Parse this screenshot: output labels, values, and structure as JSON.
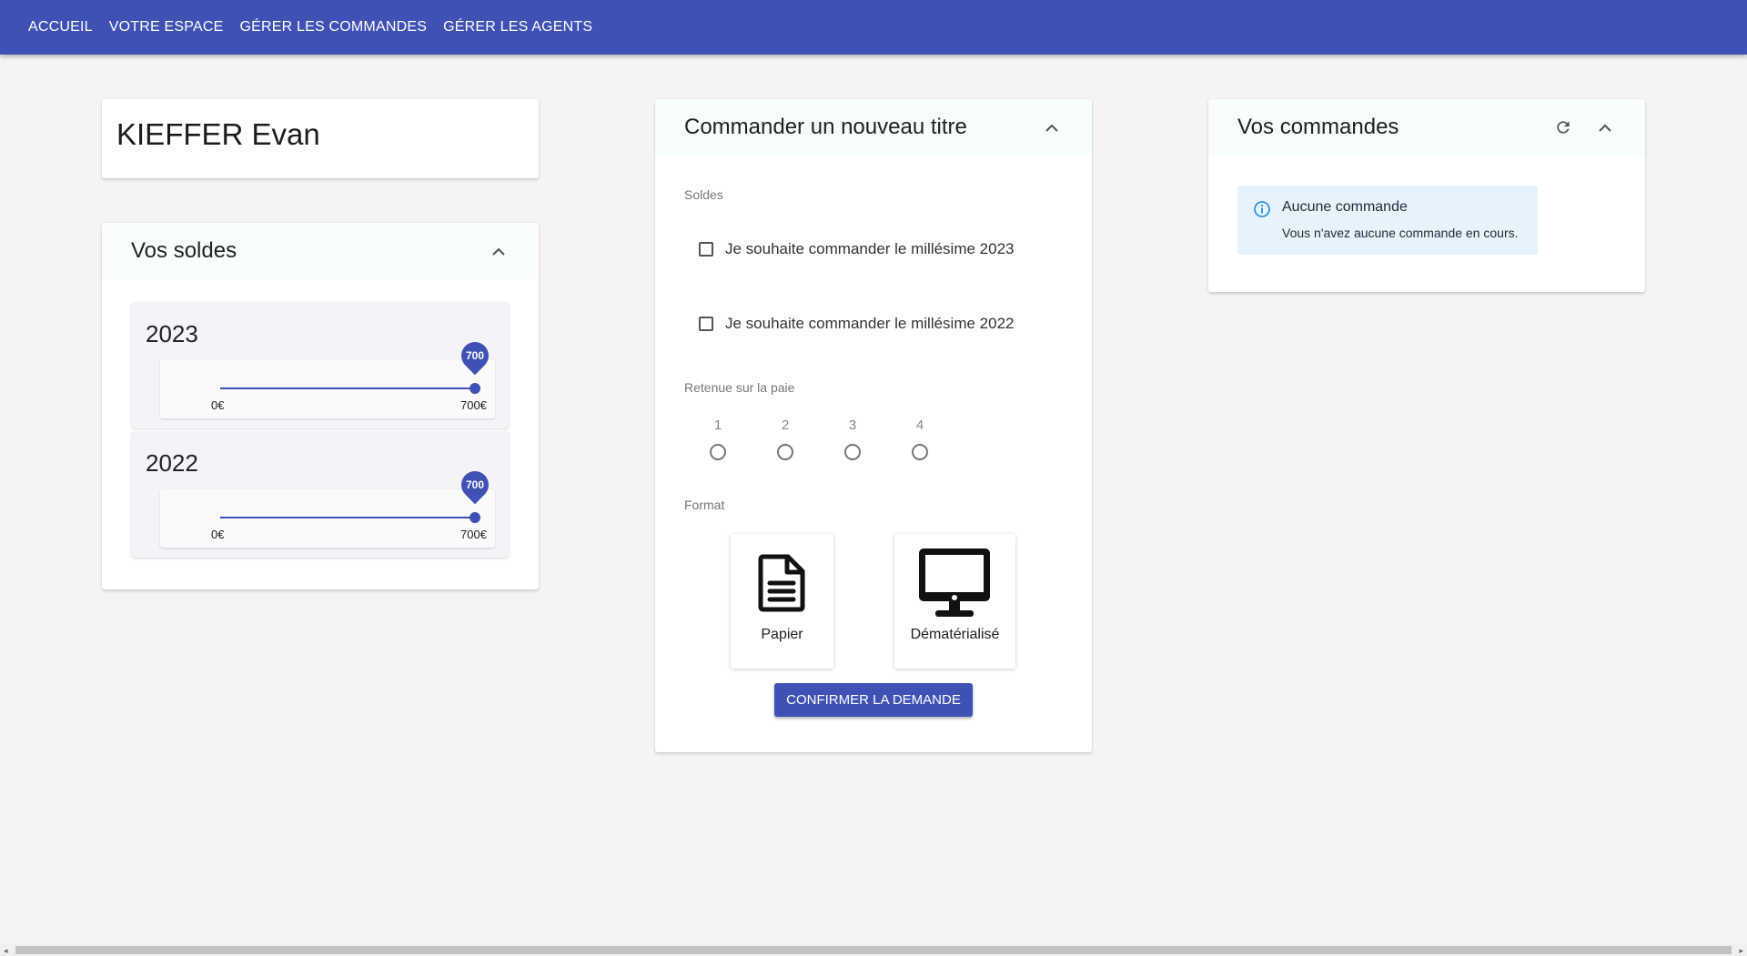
{
  "nav": {
    "items": [
      {
        "label": "Accueil"
      },
      {
        "label": "Votre espace"
      },
      {
        "label": "Gérer les commandes"
      },
      {
        "label": "Gérer les agents"
      }
    ]
  },
  "profile": {
    "name": "KIEFFER Evan"
  },
  "soldes": {
    "title": "Vos soldes",
    "years": [
      {
        "year": "2023",
        "value": "700",
        "min_label": "0€",
        "max_label": "700€",
        "fraction": 1.0
      },
      {
        "year": "2022",
        "value": "700",
        "min_label": "0€",
        "max_label": "700€",
        "fraction": 1.0
      }
    ]
  },
  "order": {
    "title": "Commander un nouveau titre",
    "soldes_label": "Soldes",
    "checkboxes": [
      {
        "label": "Je souhaite commander le millésime 2023",
        "checked": false
      },
      {
        "label": "Je souhaite commander le millésime 2022",
        "checked": false
      }
    ],
    "retenue_label": "Retenue sur la paie",
    "radios": [
      "1",
      "2",
      "3",
      "4"
    ],
    "format_label": "Format",
    "formats": [
      {
        "label": "Papier",
        "icon": "document-icon"
      },
      {
        "label": "Dématérialisé",
        "icon": "monitor-icon"
      }
    ],
    "confirm_label": "Confirmer la demande"
  },
  "commandes": {
    "title": "Vos commandes",
    "empty_title": "Aucune commande",
    "empty_text": "Vous n'avez aucune commande en cours."
  },
  "colors": {
    "primary": "#3f51b5",
    "info_bg": "#e6f2fc",
    "info_icon": "#1e88e5"
  }
}
